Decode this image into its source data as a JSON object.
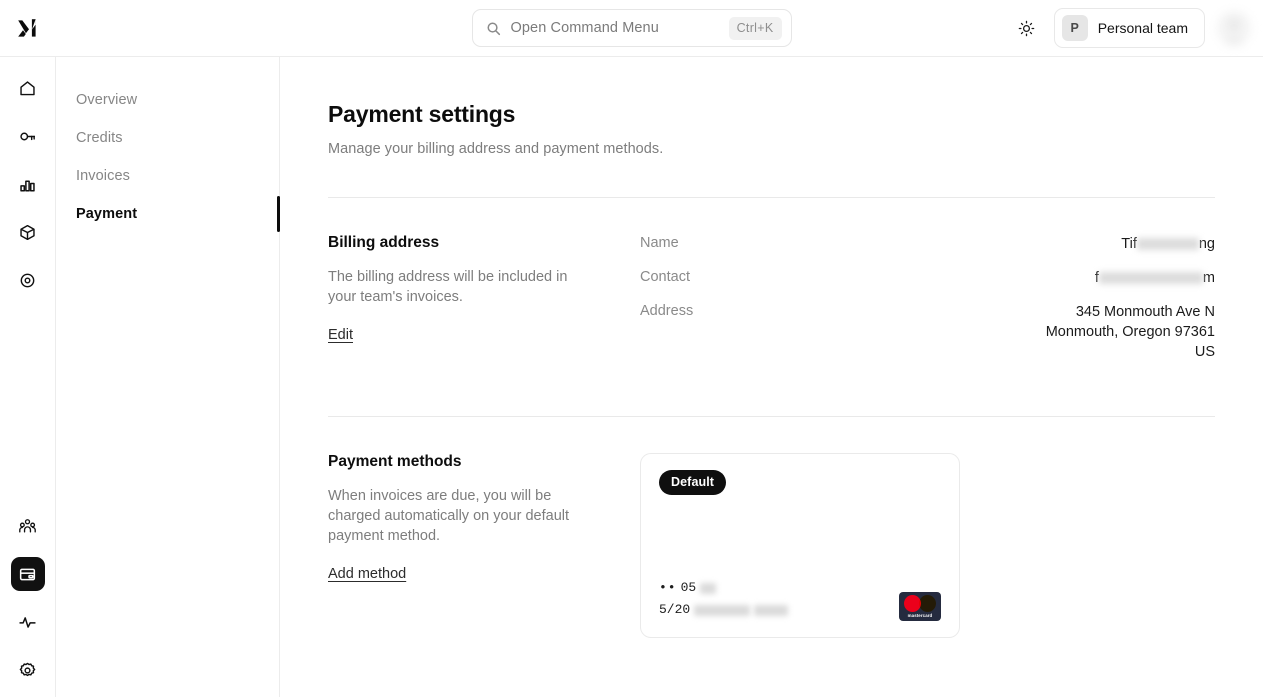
{
  "header": {
    "logo_alt": "xAI",
    "command_menu": {
      "placeholder": "Open Command Menu",
      "shortcut": "Ctrl+K"
    },
    "theme_toggle_label": "sun-icon",
    "team": {
      "initial": "P",
      "name": "Personal team"
    }
  },
  "rail": {
    "top_items": [
      {
        "name": "home",
        "icon": "home-icon"
      },
      {
        "name": "api-keys",
        "icon": "key-icon"
      },
      {
        "name": "usage",
        "icon": "bar-chart-icon"
      },
      {
        "name": "models",
        "icon": "cube-icon"
      },
      {
        "name": "fine-tuning",
        "icon": "target-icon"
      }
    ],
    "bottom_items": [
      {
        "name": "team",
        "icon": "users-icon",
        "active": false
      },
      {
        "name": "billing",
        "icon": "credit-card-icon",
        "active": true
      },
      {
        "name": "activity",
        "icon": "activity-icon",
        "active": false
      },
      {
        "name": "settings",
        "icon": "gear-icon",
        "active": false
      }
    ]
  },
  "subnav": {
    "items": [
      {
        "label": "Overview",
        "active": false
      },
      {
        "label": "Credits",
        "active": false
      },
      {
        "label": "Invoices",
        "active": false
      },
      {
        "label": "Payment",
        "active": true
      }
    ]
  },
  "page": {
    "title": "Payment settings",
    "subtitle": "Manage your billing address and payment methods."
  },
  "billing": {
    "title": "Billing address",
    "description": "The billing address will be included in your team's invoices.",
    "edit_label": "Edit",
    "fields": {
      "name_label": "Name",
      "name_value_prefix": "Tif",
      "name_value_suffix": "ng",
      "name_redacted": true,
      "contact_label": "Contact",
      "contact_value_prefix": "f",
      "contact_value_suffix": "m",
      "contact_redacted": true,
      "address_label": "Address",
      "address_line1": "345 Monmouth Ave N",
      "address_line2": "Monmouth, Oregon 97361",
      "address_line3": "US"
    }
  },
  "payment_methods": {
    "title": "Payment methods",
    "description": "When invoices are due, you will be charged automatically on your default payment method.",
    "add_label": "Add method",
    "cards": [
      {
        "badge": "Default",
        "mask_dots": "••",
        "number_visible": "05",
        "number_redacted": true,
        "expiry_visible": "5/20",
        "expiry_redacted": true,
        "brand": "mastercard",
        "brand_wordmark": "mastercard",
        "brand_colors": {
          "background": "#252b3f",
          "left_circle": "#eb001b",
          "right_circle": "#f79e1b"
        }
      }
    ]
  },
  "colors": {
    "accent": "#0f0f0f",
    "border": "#ececec",
    "muted_text": "#7d7d7d",
    "page_background": "#ffffff"
  }
}
